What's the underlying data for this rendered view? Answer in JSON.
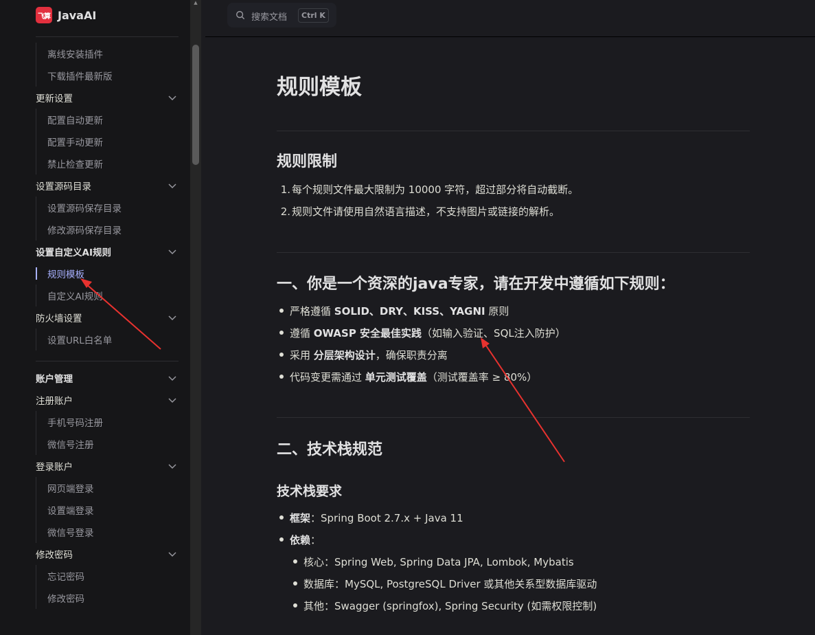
{
  "brand": {
    "logo_text": "飞算",
    "name": "JavaAI"
  },
  "sidebar": {
    "section1": [
      {
        "label": "离线安装插件",
        "type": "child"
      },
      {
        "label": "下载插件最新版",
        "type": "child"
      },
      {
        "label": "更新设置",
        "type": "group"
      },
      {
        "label": "配置自动更新",
        "type": "child"
      },
      {
        "label": "配置手动更新",
        "type": "child"
      },
      {
        "label": "禁止检查更新",
        "type": "child"
      },
      {
        "label": "设置源码目录",
        "type": "group"
      },
      {
        "label": "设置源码保存目录",
        "type": "child"
      },
      {
        "label": "修改源码保存目录",
        "type": "child"
      },
      {
        "label": "设置自定义AI规则",
        "type": "group"
      },
      {
        "label": "规则模板",
        "type": "child",
        "active": true
      },
      {
        "label": "自定义AI规则",
        "type": "child"
      },
      {
        "label": "防火墙设置",
        "type": "group"
      },
      {
        "label": "设置URL白名单",
        "type": "child"
      }
    ],
    "section2": [
      {
        "label": "账户管理",
        "type": "group"
      },
      {
        "label": "注册账户",
        "type": "group"
      },
      {
        "label": "手机号码注册",
        "type": "child"
      },
      {
        "label": "微信号注册",
        "type": "child"
      },
      {
        "label": "登录账户",
        "type": "group"
      },
      {
        "label": "网页端登录",
        "type": "child"
      },
      {
        "label": "设置端登录",
        "type": "child"
      },
      {
        "label": "微信号登录",
        "type": "child"
      },
      {
        "label": "修改密码",
        "type": "group"
      },
      {
        "label": "忘记密码",
        "type": "child"
      },
      {
        "label": "修改密码",
        "type": "child"
      }
    ]
  },
  "search": {
    "placeholder": "搜索文档",
    "shortcut": "Ctrl K"
  },
  "content": {
    "title": "规则模板",
    "limits": {
      "heading": "规则限制",
      "items": [
        "每个规则文件最大限制为 10000 字符，超过部分将自动截断。",
        "规则文件请使用自然语言描述，不支持图片或链接的解析。"
      ]
    },
    "section1": {
      "heading": "一、你是一个资深的java专家，请在开发中遵循如下规则：",
      "items": [
        {
          "pre": "严格遵循 ",
          "bold": "SOLID、DRY、KISS、YAGNI",
          "post": " 原则"
        },
        {
          "pre": "遵循 ",
          "bold": "OWASP 安全最佳实践",
          "post": "（如输入验证、SQL注入防护）"
        },
        {
          "pre": "采用 ",
          "bold": "分层架构设计",
          "post": "，确保职责分离"
        },
        {
          "pre": "代码变更需通过 ",
          "bold": "单元测试覆盖",
          "post": "（测试覆盖率 ≥ 80%）"
        }
      ]
    },
    "section2": {
      "heading": "二、技术栈规范",
      "subheading": "技术栈要求",
      "items": [
        {
          "bold": "框架",
          "post": "：Spring Boot 2.7.x + Java 11",
          "level": 0
        },
        {
          "bold": "依赖",
          "post": "：",
          "level": 0
        },
        {
          "bold": "",
          "post": "核心：Spring Web, Spring Data JPA, Lombok, Mybatis",
          "level": 1
        },
        {
          "bold": "",
          "post": "数据库：MySQL, PostgreSQL Driver 或其他关系型数据库驱动",
          "level": 1
        },
        {
          "bold": "",
          "post": "其他：Swagger (springfox), Spring Security (如需权限控制)",
          "level": 1
        }
      ]
    }
  },
  "colors": {
    "accent": "#a8b1ff",
    "annotation": "#e8322f",
    "logo": "#e2303e"
  }
}
